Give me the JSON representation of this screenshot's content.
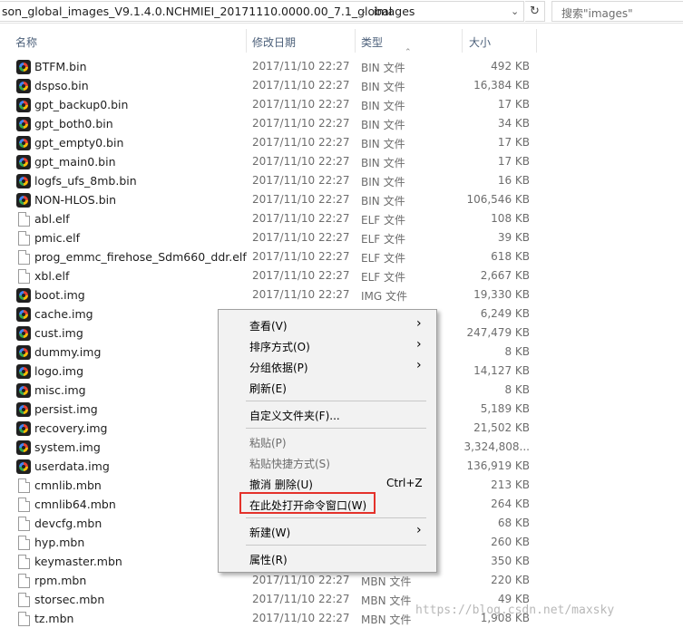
{
  "address_bar": {
    "path_segment": "son_global_images_V9.1.4.0.NCHMIEI_20171110.0000.00_7.1_global",
    "separator": "›",
    "current_folder": "images",
    "search_placeholder": "搜索\"images\""
  },
  "columns": {
    "name": "名称",
    "date": "修改日期",
    "type": "类型",
    "size": "大小"
  },
  "files": [
    {
      "name": "BTFM.bin",
      "date": "2017/11/10 22:27",
      "type": "BIN 文件",
      "size": "492 KB",
      "icon": "app-icon"
    },
    {
      "name": "dspso.bin",
      "date": "2017/11/10 22:27",
      "type": "BIN 文件",
      "size": "16,384 KB",
      "icon": "app-icon"
    },
    {
      "name": "gpt_backup0.bin",
      "date": "2017/11/10 22:27",
      "type": "BIN 文件",
      "size": "17 KB",
      "icon": "app-icon"
    },
    {
      "name": "gpt_both0.bin",
      "date": "2017/11/10 22:27",
      "type": "BIN 文件",
      "size": "34 KB",
      "icon": "app-icon"
    },
    {
      "name": "gpt_empty0.bin",
      "date": "2017/11/10 22:27",
      "type": "BIN 文件",
      "size": "17 KB",
      "icon": "app-icon"
    },
    {
      "name": "gpt_main0.bin",
      "date": "2017/11/10 22:27",
      "type": "BIN 文件",
      "size": "17 KB",
      "icon": "app-icon"
    },
    {
      "name": "logfs_ufs_8mb.bin",
      "date": "2017/11/10 22:27",
      "type": "BIN 文件",
      "size": "16 KB",
      "icon": "app-icon"
    },
    {
      "name": "NON-HLOS.bin",
      "date": "2017/11/10 22:27",
      "type": "BIN 文件",
      "size": "106,546 KB",
      "icon": "app-icon"
    },
    {
      "name": "abl.elf",
      "date": "2017/11/10 22:27",
      "type": "ELF 文件",
      "size": "108 KB",
      "icon": "file-icon"
    },
    {
      "name": "pmic.elf",
      "date": "2017/11/10 22:27",
      "type": "ELF 文件",
      "size": "39 KB",
      "icon": "file-icon"
    },
    {
      "name": "prog_emmc_firehose_Sdm660_ddr.elf",
      "date": "2017/11/10 22:27",
      "type": "ELF 文件",
      "size": "618 KB",
      "icon": "file-icon"
    },
    {
      "name": "xbl.elf",
      "date": "2017/11/10 22:27",
      "type": "ELF 文件",
      "size": "2,667 KB",
      "icon": "file-icon"
    },
    {
      "name": "boot.img",
      "date": "2017/11/10 22:27",
      "type": "IMG 文件",
      "size": "19,330 KB",
      "icon": "app-icon"
    },
    {
      "name": "cache.img",
      "date": "",
      "type": "",
      "size": "6,249 KB",
      "icon": "app-icon"
    },
    {
      "name": "cust.img",
      "date": "",
      "type": "",
      "size": "247,479 KB",
      "icon": "app-icon"
    },
    {
      "name": "dummy.img",
      "date": "",
      "type": "",
      "size": "8 KB",
      "icon": "app-icon"
    },
    {
      "name": "logo.img",
      "date": "",
      "type": "",
      "size": "14,127 KB",
      "icon": "app-icon"
    },
    {
      "name": "misc.img",
      "date": "",
      "type": "",
      "size": "8 KB",
      "icon": "app-icon"
    },
    {
      "name": "persist.img",
      "date": "",
      "type": "",
      "size": "5,189 KB",
      "icon": "app-icon"
    },
    {
      "name": "recovery.img",
      "date": "",
      "type": "",
      "size": "21,502 KB",
      "icon": "app-icon"
    },
    {
      "name": "system.img",
      "date": "",
      "type": "",
      "size": "3,324,808...",
      "icon": "app-icon"
    },
    {
      "name": "userdata.img",
      "date": "",
      "type": "",
      "size": "136,919 KB",
      "icon": "app-icon"
    },
    {
      "name": "cmnlib.mbn",
      "date": "",
      "type": "",
      "size": "213 KB",
      "icon": "file-icon"
    },
    {
      "name": "cmnlib64.mbn",
      "date": "",
      "type": "",
      "size": "264 KB",
      "icon": "file-icon"
    },
    {
      "name": "devcfg.mbn",
      "date": "",
      "type": "",
      "size": "68 KB",
      "icon": "file-icon"
    },
    {
      "name": "hyp.mbn",
      "date": "",
      "type": "",
      "size": "260 KB",
      "icon": "file-icon"
    },
    {
      "name": "keymaster.mbn",
      "date": "",
      "type": "",
      "size": "350 KB",
      "icon": "file-icon"
    },
    {
      "name": "rpm.mbn",
      "date": "2017/11/10 22:27",
      "type": "MBN 文件",
      "size": "220 KB",
      "icon": "file-icon"
    },
    {
      "name": "storsec.mbn",
      "date": "2017/11/10 22:27",
      "type": "MBN 文件",
      "size": "49 KB",
      "icon": "file-icon"
    },
    {
      "name": "tz.mbn",
      "date": "2017/11/10 22:27",
      "type": "MBN 文件",
      "size": "1,908 KB",
      "icon": "file-icon"
    }
  ],
  "context_menu": {
    "view": "查看(V)",
    "sort_by": "排序方式(O)",
    "group_by": "分组依据(P)",
    "refresh": "刷新(E)",
    "customize_folder": "自定义文件夹(F)...",
    "paste": "粘贴(P)",
    "paste_shortcut": "粘贴快捷方式(S)",
    "undo_delete": "撤消 删除(U)",
    "undo_shortcut": "Ctrl+Z",
    "open_command_window": "在此处打开命令窗口(W)",
    "new": "新建(W)",
    "properties": "属性(R)",
    "highlight_color": "#e4322b"
  },
  "watermark": "https://blog.csdn.net/maxsky"
}
